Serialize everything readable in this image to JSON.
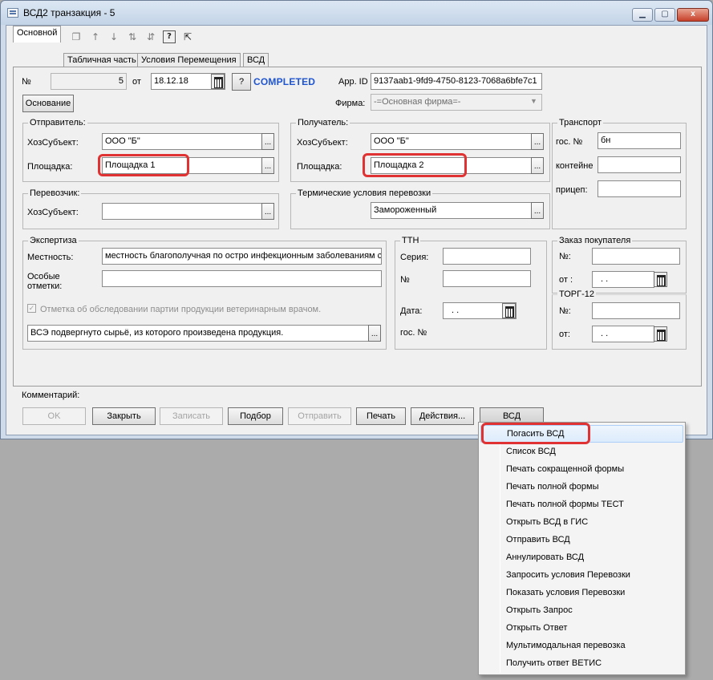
{
  "window": {
    "title": "ВСД2 транзакция - 5",
    "min_icon": "minimize-icon",
    "max_icon": "maximize-icon",
    "close_icon": "close-icon",
    "close_glyph": "x"
  },
  "toolbar": {
    "icons": [
      "add-row-icon",
      "insert-row-icon",
      "delete-row-icon",
      "copy-row-icon",
      "move-up-icon",
      "move-down-icon",
      "sort-ascending-icon",
      "sort-descending-icon",
      "help-icon",
      "context-help-icon"
    ]
  },
  "tabs": [
    "Основной",
    "Табличная часть",
    "Условия Перемещения",
    "ВСД"
  ],
  "header": {
    "number_label": "№",
    "number_value": "5",
    "date_label": "от",
    "date_value": "18.12.18",
    "help_button": "?",
    "status": "COMPLETED",
    "app_id_label": "App. ID",
    "app_id_value": "9137aab1-9fd9-4750-8123-7068a6bfe7c1",
    "basis_button": "Основание",
    "firm_label": "Фирма:",
    "firm_value": "-=Основная фирма=-"
  },
  "sender": {
    "title": "Отправитель:",
    "entity_label": "ХозСубъект:",
    "entity_value": "ООО \"Б\"",
    "site_label": "Площадка:",
    "site_value": "Площадка 1"
  },
  "recipient": {
    "title": "Получатель:",
    "entity_label": "ХозСубъект:",
    "entity_value": "ООО \"Б\"",
    "site_label": "Площадка:",
    "site_value": "Площадка 2"
  },
  "transport": {
    "title": "Транспорт",
    "gos_label": "гос. №",
    "gos_value": "бн",
    "container_label": "контейне",
    "container_value": "",
    "trailer_label": "прицеп:",
    "trailer_value": ""
  },
  "carrier": {
    "title": "Перевозчик:",
    "entity_label": "ХозСубъект:",
    "entity_value": ""
  },
  "thermal": {
    "title": "Термические условия перевозки",
    "value": "Замороженный"
  },
  "expertise": {
    "title": "Экспертиза",
    "locality_label": "Местность:",
    "locality_value": "местность благополучная по остро инфекционным заболеваниям с",
    "marks_label_1": "Особые",
    "marks_label_2": "отметки:",
    "marks_value": "",
    "checkbox_label": "Отметка об обследовании партии продукции ветеринарным врачом.",
    "checkbox_glyph": "✓",
    "checkbox_checked": true,
    "statement_value": "ВСЭ подвергнуто сырьё, из которого произведена продукция."
  },
  "ttn": {
    "title": "ТТН",
    "series_label": "Серия:",
    "series_value": "",
    "number_label": "№",
    "number_value": "",
    "date_label": "Дата:",
    "date_value": ". .",
    "gos_label": "гос. №"
  },
  "customer_order": {
    "title": "Заказ покупателя",
    "number_label": "№:",
    "number_value": "",
    "date_label": "от :",
    "date_value": ". ."
  },
  "torg12": {
    "title": "ТОРГ-12",
    "number_label": "№:",
    "number_value": "",
    "date_label": "от:",
    "date_value": ". ."
  },
  "comment_label": "Комментарий:",
  "buttons": {
    "ok": "OK",
    "close": "Закрыть",
    "save": "Записать",
    "select": "Подбор",
    "send": "Отправить",
    "print": "Печать",
    "actions": "Действия...",
    "vsd": "ВСД",
    "dots": "..."
  },
  "menu": {
    "items": [
      "Погасить ВСД",
      "Список ВСД",
      "Печать сокращенной формы",
      "Печать полной формы",
      "Печать полной формы ТЕСТ",
      "Открыть ВСД в ГИС",
      "Отправить ВСД",
      "Аннулировать ВСД",
      "Запросить условия Перевозки",
      "Показать условия Перевозки",
      "Открыть Запрос",
      "Открыть Ответ",
      "Мультимодальная перевозка",
      "Получить ответ ВЕТИС"
    ],
    "selected_index": 0
  },
  "colors": {
    "highlight": "#e03232",
    "status_text": "#1f55d0"
  }
}
